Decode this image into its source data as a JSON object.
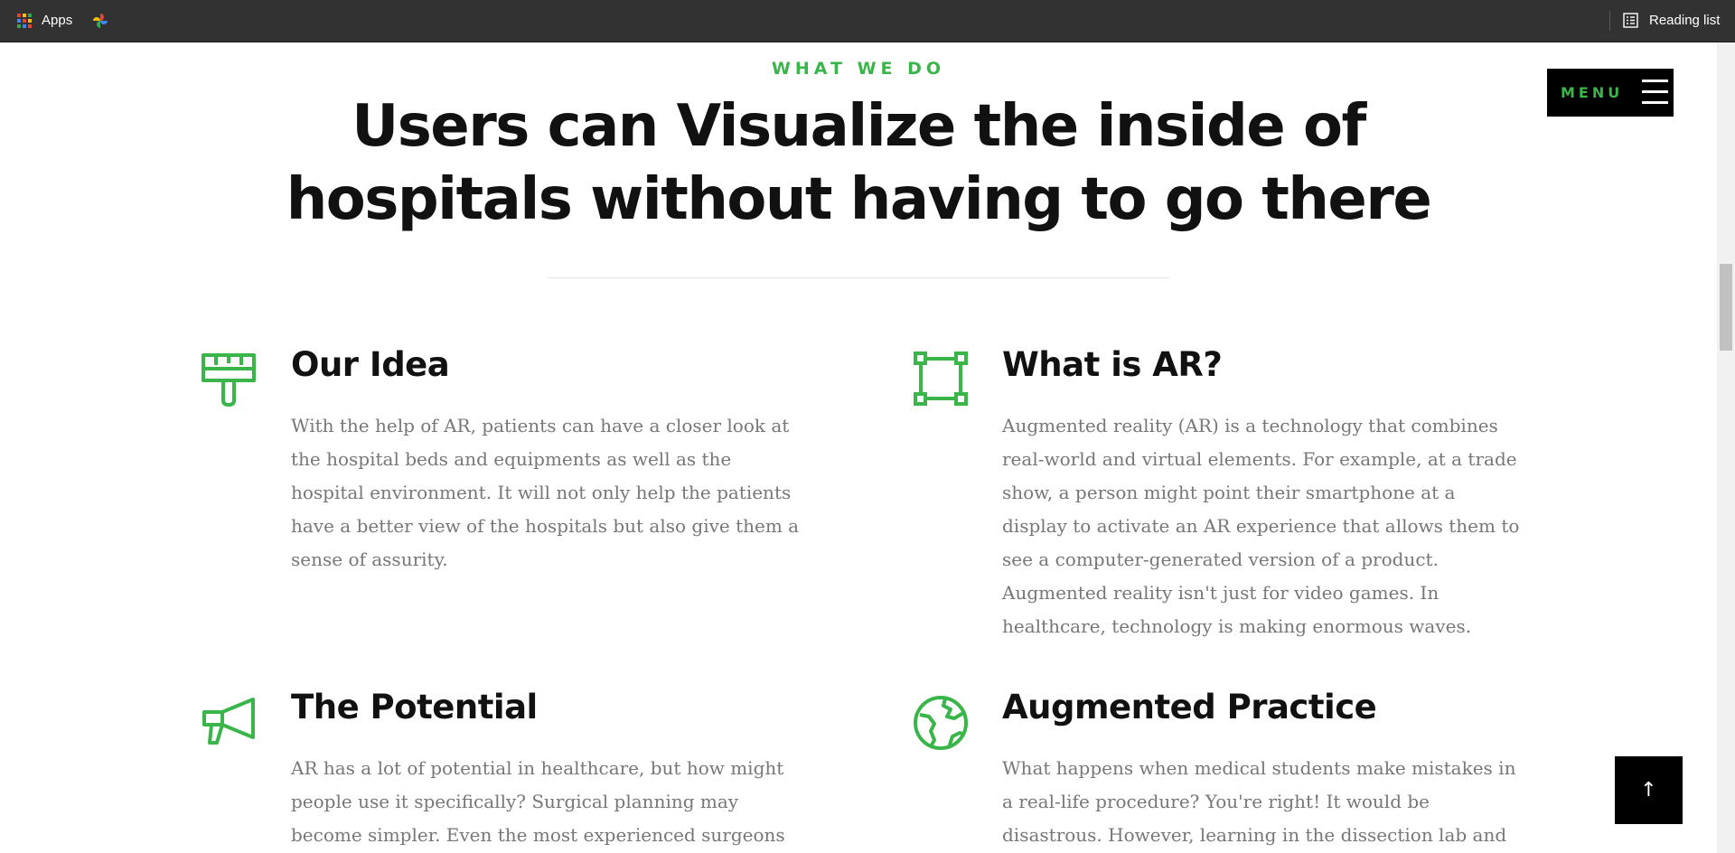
{
  "browser": {
    "apps_label": "Apps",
    "reading_list_label": "Reading list"
  },
  "colors": {
    "accent": "#3ab54a",
    "text": "#111111",
    "muted": "#777777"
  },
  "header": {
    "eyebrow": "WHAT WE DO",
    "headline_line1": "Users can Visualize the inside of",
    "headline_line2": "hospitals without having to go there"
  },
  "menu": {
    "label": "MENU"
  },
  "back_to_top": {
    "glyph": "↑"
  },
  "features": [
    {
      "icon": "paintbrush-icon",
      "title": "Our Idea",
      "text": "With the help of AR, patients can have a closer look at the hospital beds and equipments as well as the hospital environment. It will not only help the patients have a better view of the hospitals but also give them a sense of assurity."
    },
    {
      "icon": "vector-square-icon",
      "title": "What is AR?",
      "text": "Augmented reality (AR) is a technology that combines real-world and virtual elements. For example, at a trade show, a person might point their smartphone at a display to activate an AR experience that allows them to see a computer-generated version of a product. Augmented reality isn't just for video games. In healthcare, technology is making enormous waves."
    },
    {
      "icon": "megaphone-icon",
      "title": "The Potential",
      "text": "AR has a lot of potential in healthcare, but how might people use it specifically? Surgical planning may become simpler. Even the most experienced surgeons face"
    },
    {
      "icon": "globe-icon",
      "title": "Augmented Practice",
      "text": "What happens when medical students make mistakes in a real-life procedure? You're right! It would be disastrous. However, learning in the dissection lab and"
    }
  ]
}
